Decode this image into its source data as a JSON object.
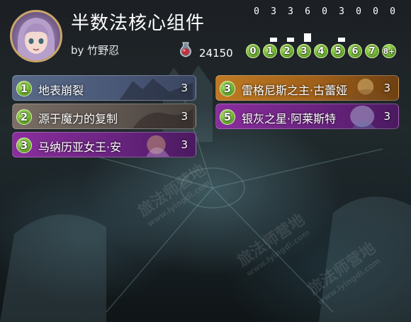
{
  "deck": {
    "title": "半数法核心组件",
    "author": "by 竹野忍",
    "dust": "24150"
  },
  "mana_curve": {
    "counts": [
      "0",
      "3",
      "3",
      "6",
      "0",
      "3",
      "0",
      "0",
      "0"
    ],
    "values": [
      0,
      3,
      3,
      6,
      0,
      3,
      0,
      0,
      0
    ],
    "gems": [
      "0",
      "1",
      "2",
      "3",
      "4",
      "5",
      "6",
      "7",
      "8+"
    ]
  },
  "cards": [
    {
      "cost": "1",
      "name": "地表崩裂",
      "count": "3",
      "rarity": "rare"
    },
    {
      "cost": "2",
      "name": "源于魔力的复制",
      "count": "3",
      "rarity": "common"
    },
    {
      "cost": "3",
      "name": "马纳历亚女王·安",
      "count": "3",
      "rarity": "epic"
    },
    {
      "cost": "3",
      "name": "雷格尼斯之主·古蕾娅",
      "count": "3",
      "rarity": "legendary"
    },
    {
      "cost": "5",
      "name": "银灰之星·阿莱斯特",
      "count": "3",
      "rarity": "epic"
    }
  ],
  "watermark": {
    "text": "旅法师营地",
    "url": "www.lyingdi.com"
  },
  "colors": {
    "gem_green": "#7cc23a",
    "rare": "#586a88",
    "common": "#7a6e66",
    "epic": "#8a2e9e",
    "legendary": "#c07a22"
  }
}
